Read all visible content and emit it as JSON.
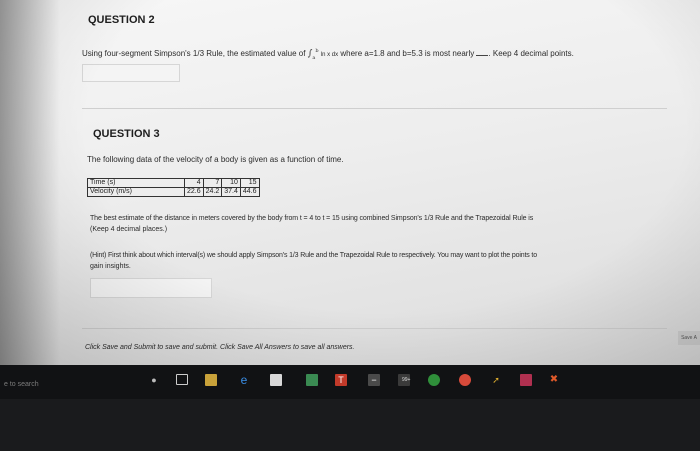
{
  "q2": {
    "title": "QUESTION 2",
    "prompt_before": "Using four-segment Simpson's 1/3 Rule, the estimated value of",
    "integrand": "ln x dx",
    "prompt_after": "where a=1.8 and b=5.3 is most nearly",
    "suffix": ". Keep 4 decimal points."
  },
  "q3": {
    "title": "QUESTION 3",
    "intro": "The following data of the velocity of a body is given as a function of time.",
    "table": {
      "time_label": "Time (s)",
      "velocity_label": "Velocity (m/s)",
      "time": [
        "4",
        "7",
        "10",
        "15"
      ],
      "velocity": [
        "22.6",
        "24.2",
        "37.4",
        "44.6"
      ]
    },
    "question_line1": "The best estimate of the distance in meters covered by the body from t = 4 to t = 15 using combined Simpson's 1/3 Rule and the Trapezoidal Rule is",
    "question_line2": "(Keep 4 decimal places.)",
    "hint_line1": "(Hint) First think about which interval(s) we should apply Simpson's 1/3 Rule and the Trapezoidal Rule to respectively. You may want to plot the points to",
    "hint_line2": "gain insights."
  },
  "footer": {
    "instruction": "Click Save and Submit to save and submit. Click Save All Answers to save all answers.",
    "save_tab": "Save A"
  },
  "taskbar": {
    "search_text": "e to search",
    "battery_label": "99+"
  }
}
